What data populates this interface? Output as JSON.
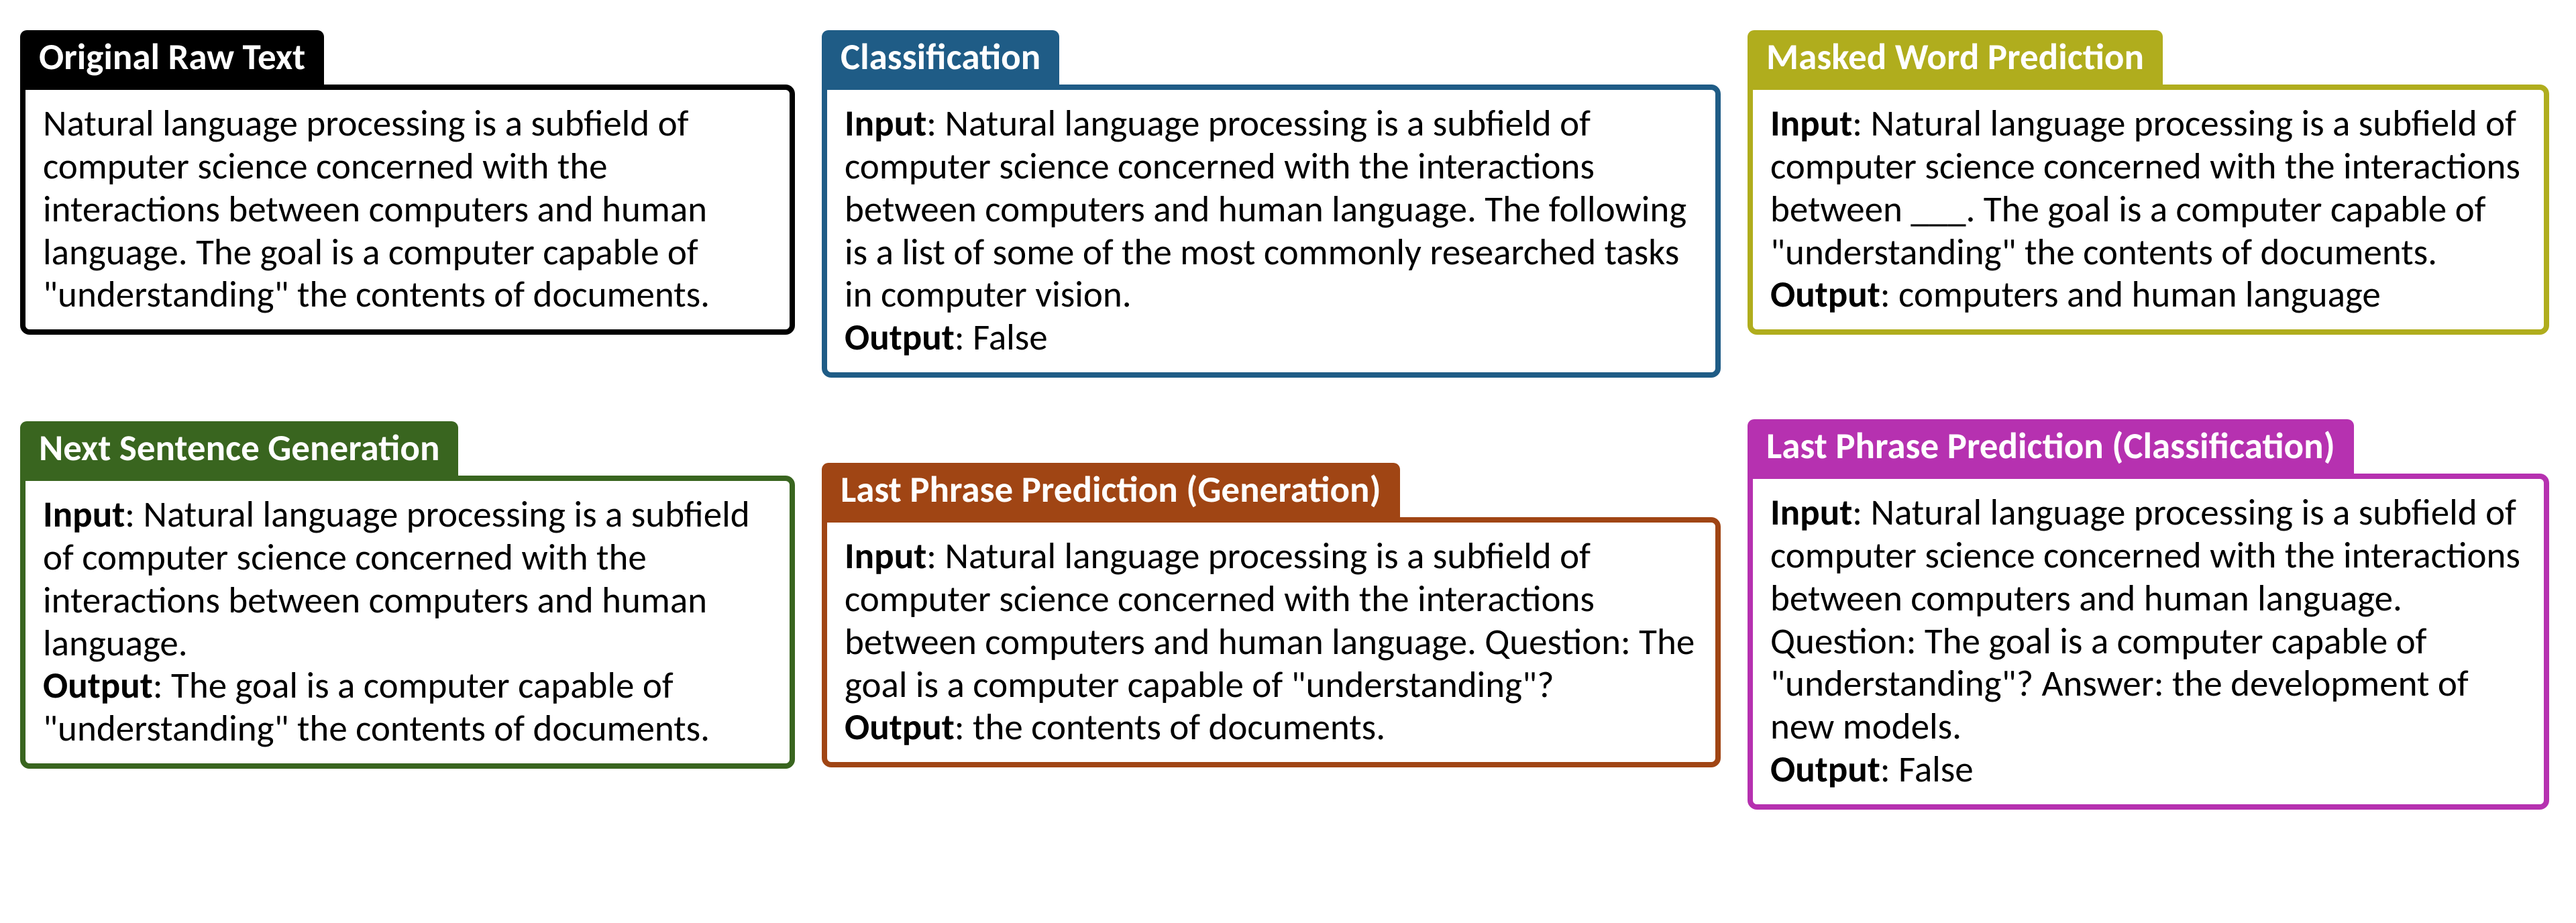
{
  "cards": {
    "raw": {
      "title": "Original Raw Text",
      "color": "#000000",
      "text": "Natural language processing is a subfield of computer science concerned with the interactions between computers and human language. The goal is a computer capable of \"understanding\" the contents of documents."
    },
    "nextsent": {
      "title": "Next Sentence Generation",
      "color": "#39651f",
      "input": "Natural language processing is a subfield of computer science concerned with the interactions between computers and human language.",
      "output": "The goal is a computer capable of \"understanding\" the contents of documents."
    },
    "classification": {
      "title": "Classification",
      "color": "#1f5c86",
      "input": "Natural language processing is a subfield of computer science concerned with the interactions between computers and human language. The following is a list of some of the most commonly researched tasks in computer vision.",
      "output": "False"
    },
    "lastgen": {
      "title": "Last Phrase Prediction (Generation)",
      "color": "#a04514",
      "input": "Natural language processing is a subfield of computer science concerned with the interactions between computers and human language. Question: The goal is a computer capable of \"understanding\"?",
      "output": "the contents of documents."
    },
    "masked": {
      "title": "Masked Word Prediction",
      "color": "#b0ad1d",
      "input": "Natural language processing is a subfield of computer science concerned with the interactions between ___. The goal is a computer capable of \"understanding\" the contents of documents.",
      "output": "computers and human language"
    },
    "lastclass": {
      "title": "Last Phrase Prediction (Classification)",
      "color": "#b631b0",
      "input": "Natural language processing is a subfield of computer science concerned with the interactions between computers and human language. Question: The goal is a computer capable of \"understanding\"? Answer: the development of new models.",
      "output": "False"
    }
  },
  "labels": {
    "input": "Input",
    "output": "Output"
  }
}
